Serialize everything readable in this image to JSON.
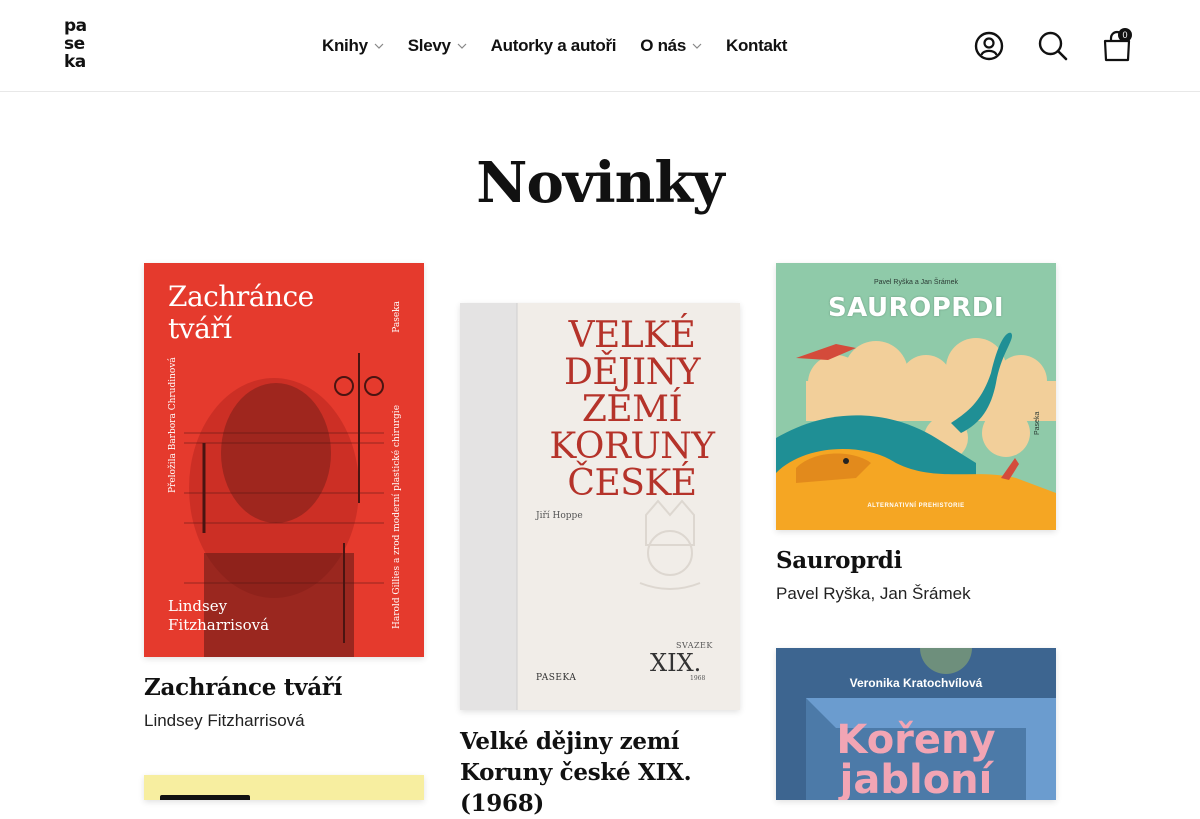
{
  "brand": {
    "logo_lines": [
      "pa",
      "se",
      "ka"
    ]
  },
  "nav": {
    "items": [
      {
        "label": "Knihy",
        "has_dropdown": true
      },
      {
        "label": "Slevy",
        "has_dropdown": true
      },
      {
        "label": "Autorky a autoři",
        "has_dropdown": false
      },
      {
        "label": "O nás",
        "has_dropdown": true
      },
      {
        "label": "Kontakt",
        "has_dropdown": false
      }
    ]
  },
  "header_icons": {
    "account": "user-icon",
    "search": "search-icon",
    "cart": "cart-icon",
    "cart_count": "0"
  },
  "page": {
    "title": "Novinky"
  },
  "books": [
    {
      "title": "Zachránce tváří",
      "author": "Lindsey Fitzharrisová",
      "cover": {
        "title_lines": [
          "Zachránce",
          "tváří"
        ],
        "side_text": "Přeložila Barbora Chrudinová",
        "spine_text": "Harold Gillies a zrod moderní plastické chirurgie",
        "publisher": "Paseka",
        "author_lines": [
          "Lindsey",
          "Fitzharrisová"
        ],
        "color": "#e8392c"
      }
    },
    {
      "title_lines": [
        "Velké dějiny zemí",
        "Koruny české XIX.",
        "(1968)"
      ],
      "cover": {
        "title_lines": [
          "Velké",
          "dějiny",
          "zemí",
          "Koruny",
          "české"
        ],
        "author": "Jiří Hoppe",
        "volume_label": "SVAZEK",
        "volume": "XIX.",
        "year": "1968",
        "publisher": "PASEKA",
        "color": "#b5332a"
      }
    },
    {
      "title": "Sauroprdi",
      "author": "Pavel Ryška, Jan Šrámek",
      "cover": {
        "authors_line": "Pavel Ryška a Jan Šrámek",
        "title": "SAUROPRDI",
        "subtitle": "ALTERNATIVNÍ PREHISTORIE",
        "publisher": "Paseka"
      }
    },
    {
      "title": "",
      "cover": {
        "author": "Veronika Kratochvílová",
        "title_lines": [
          "Kořeny",
          "jabloní"
        ]
      }
    },
    {
      "title": "",
      "cover": {
        "color": "#f7eea0"
      }
    }
  ]
}
